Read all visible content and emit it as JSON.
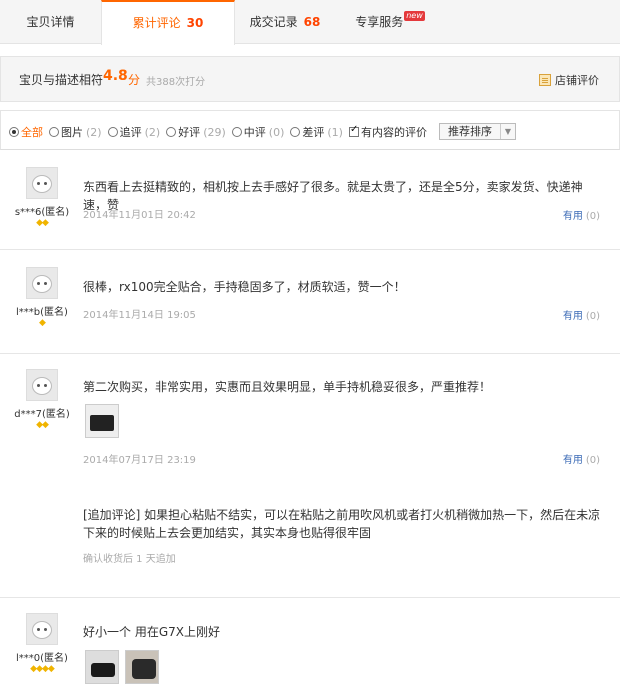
{
  "tabs": [
    {
      "label": "宝贝详情",
      "count": ""
    },
    {
      "label": "累计评论",
      "count": "30"
    },
    {
      "label": "成交记录",
      "count": "68"
    },
    {
      "label": "专享服务",
      "badge": "new"
    }
  ],
  "rating": {
    "label": "宝贝与描述相符",
    "score": "4.8",
    "unit": "分",
    "times": "共388次打分",
    "shop_eval": "店铺评价"
  },
  "filters": {
    "options": [
      {
        "label": "全部",
        "count": ""
      },
      {
        "label": "图片",
        "count": "(2)"
      },
      {
        "label": "追评",
        "count": "(2)"
      },
      {
        "label": "好评",
        "count": "(29)"
      },
      {
        "label": "中评",
        "count": "(0)"
      },
      {
        "label": "差评",
        "count": "(1)"
      }
    ],
    "with_content": "有内容的评价",
    "sort": "推荐排序"
  },
  "reviews": [
    {
      "user": "s***6(匿名)",
      "gems": "◆◆",
      "text": "东西看上去挺精致的，相机按上去手感好了很多。就是太贵了，还是全5分，卖家发货、快递神速，赞",
      "date": "2014年11月01日 20:42",
      "useful": "有用",
      "useful_count": "(0)"
    },
    {
      "user": "l***b(匿名)",
      "gems": "◆",
      "text": "很棒，rx100完全贴合，手持稳固多了，材质软适，赞一个！",
      "date": "2014年11月14日 19:05",
      "useful": "有用",
      "useful_count": "(0)"
    },
    {
      "user": "d***7(匿名)",
      "gems": "◆◆",
      "text": "第二次购买，非常实用，实惠而且效果明显，单手持机稳妥很多，严重推荐！",
      "date": "2014年07月17日 23:19",
      "useful": "有用",
      "useful_count": "(0)",
      "append_text": "[追加评论] 如果担心粘贴不结实，可以在粘贴之前用吹风机或者打火机稍微加热一下，然后在未凉下来的时候贴上去会更加结实，其实本身也贴得很牢固",
      "append_note": "确认收货后 1 天追加"
    },
    {
      "user": "l***0(匿名)",
      "gems": "◆◆◆◆",
      "text": "好小一个 用在G7X上刚好"
    }
  ]
}
